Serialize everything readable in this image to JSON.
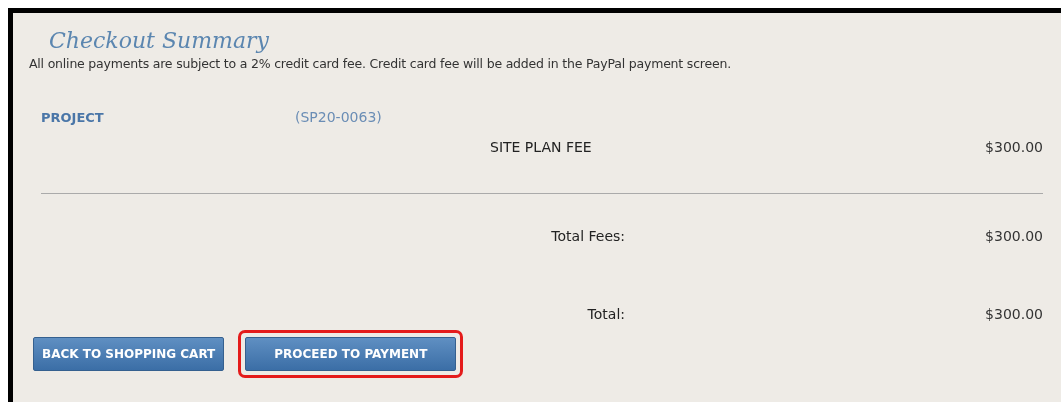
{
  "title": "Checkout Summary",
  "notice": "All online payments are subject to a 2% credit card fee. Credit card fee will be added in the PayPal payment screen.",
  "project": {
    "label": "PROJECT",
    "number": "(SP20-0063)"
  },
  "fees": [
    {
      "name": "SITE PLAN FEE",
      "amount": "$300.00"
    }
  ],
  "totals": [
    {
      "label": "Total Fees:",
      "amount": "$300.00"
    },
    {
      "label": "Total:",
      "amount": "$300.00"
    }
  ],
  "buttons": [
    {
      "label": "BACK TO SHOPPING CART",
      "highlighted": false
    },
    {
      "label": "PROCEED TO PAYMENT",
      "highlighted": true
    }
  ]
}
